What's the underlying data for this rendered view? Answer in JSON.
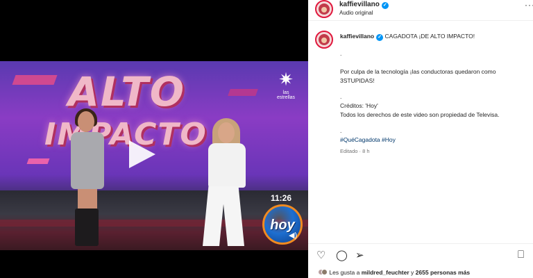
{
  "video": {
    "logo_line1": "ALTO",
    "logo_line2": "IMPACTO",
    "channel_name": "las estrellas",
    "duration": "11:26",
    "show_logo": "hoy"
  },
  "post": {
    "username": "kaffievillano",
    "audio": "Audio original"
  },
  "caption": {
    "username": "kaffievillano",
    "title": "CAGADOTA ¡DE ALTO IMPACTO!",
    "dot1": ".",
    "line1": "Por culpa de la tecnología ¡las conductoras quedaron como",
    "line2": "3STUPIDAS!",
    "dot2": ".",
    "credits": "Créditos: 'Hoy'",
    "rights": "Todos los derechos de este video son propiedad de Televisa.",
    "dot3": ".",
    "hashtags": "#QuéCagadota #Hoy",
    "edited": "Editado · 8 h"
  },
  "likes": {
    "prefix": "Les gusta a",
    "user": "mildred_feuchter",
    "connector": "y",
    "others": "2655 personas más"
  },
  "icons": {
    "like": "heart-icon",
    "comment": "comment-icon",
    "share": "send-icon",
    "save": "bookmark-icon",
    "more": "more-icon"
  },
  "colors": {
    "verified": "#0095f6",
    "hashtag": "#00376b",
    "avatar_ring": "#e0183d"
  }
}
